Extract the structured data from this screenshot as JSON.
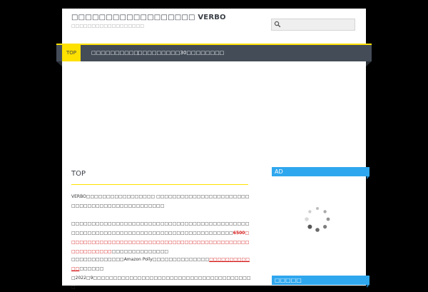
{
  "header": {
    "site_title": "□□□□□□□□□□□□□□□□□□ VERBO",
    "tagline": "□□□□□□□□□□□□□□□□□□",
    "search_placeholder": ""
  },
  "nav": {
    "items": [
      {
        "label": "TOP",
        "active": true
      },
      {
        "label": "□□□□□□□□□□",
        "active": false
      },
      {
        "label": "□□□□□□□□□30□",
        "active": false
      },
      {
        "label": "□□□□□□□",
        "active": false
      }
    ]
  },
  "main": {
    "title": "TOP",
    "para1": {
      "a": "VERBO□□□□□□□□□□□□□□□□□ □□□□□□□□□□□□□□□□□□□□□□□□□□□□□□□□□□□□□□□□□□□□□□"
    },
    "para2": {
      "a": "□□□□□□□□□□□□□□□□□□□□□□□□□□□□□□□□□□□□□□□□□□□□□□□□□□□□□□□□□□□□□□□□□□□□□□□□□□□□□□□□□□□□",
      "b": "6500",
      "c": "□□□□□□□□□□□□□□□□□□□□□□□□□□□□□□□□□□□□□□□□□□□□□□□□□□□□□□□",
      "d": "□□□□□□□□□□□□□□"
    },
    "para3": {
      "a": "□□□□□□□□□□□□□Amazon Polly□□□□□□□□□□□□□□",
      "b": "□□□□□□□□□□□□",
      "c": "□□□□□□",
      "d": "□2022□9□□□□□□□□□□□□□□□□□□□□□□□□□□□□□□□□□□□□□□□□"
    }
  },
  "sidebar": {
    "widget1_title": "AD",
    "widget2_title": "□□□□□"
  },
  "colors": {
    "accent_yellow": "#ffe100",
    "nav_bg": "#434c57",
    "widget_blue": "#2fa7ee",
    "highlight_red": "#d41515"
  },
  "icons": {
    "search": "search-icon",
    "loading": "spinner-icon"
  }
}
